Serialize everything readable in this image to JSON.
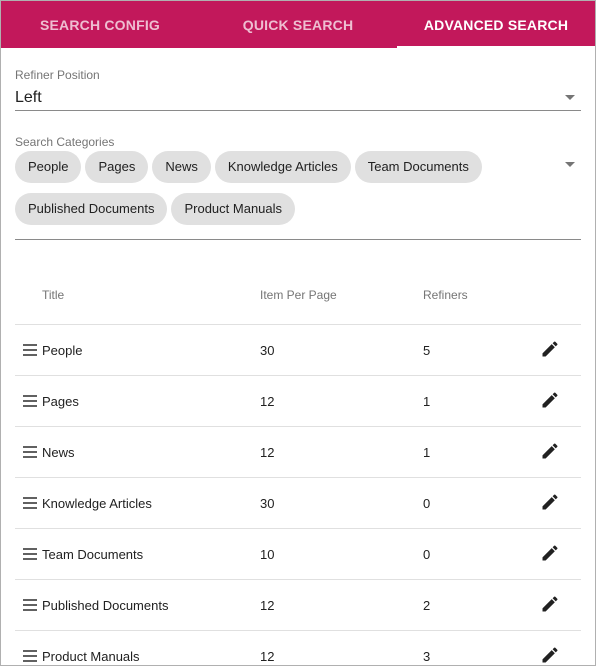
{
  "tabs": [
    {
      "label": "SEARCH CONFIG",
      "active": false
    },
    {
      "label": "QUICK SEARCH",
      "active": false
    },
    {
      "label": "ADVANCED SEARCH",
      "active": true
    }
  ],
  "refiner_position": {
    "label": "Refiner Position",
    "value": "Left"
  },
  "search_categories": {
    "label": "Search Categories",
    "chips": [
      "People",
      "Pages",
      "News",
      "Knowledge Articles",
      "Team Documents",
      "Published Documents",
      "Product Manuals"
    ]
  },
  "table": {
    "headers": {
      "title": "Title",
      "items_per_page": "Item Per Page",
      "refiners": "Refiners"
    },
    "rows": [
      {
        "title": "People",
        "items": "30",
        "refiners": "5"
      },
      {
        "title": "Pages",
        "items": "12",
        "refiners": "1"
      },
      {
        "title": "News",
        "items": "12",
        "refiners": "1"
      },
      {
        "title": "Knowledge Articles",
        "items": "30",
        "refiners": "0"
      },
      {
        "title": "Team Documents",
        "items": "10",
        "refiners": "0"
      },
      {
        "title": "Published Documents",
        "items": "12",
        "refiners": "2"
      },
      {
        "title": "Product Manuals",
        "items": "12",
        "refiners": "3"
      }
    ]
  },
  "icons": {
    "drag": "drag-handle-icon",
    "edit": "pencil-icon"
  },
  "colors": {
    "accent": "#c2185b",
    "chip_bg": "#e0e0e0",
    "muted_text": "#757575"
  }
}
